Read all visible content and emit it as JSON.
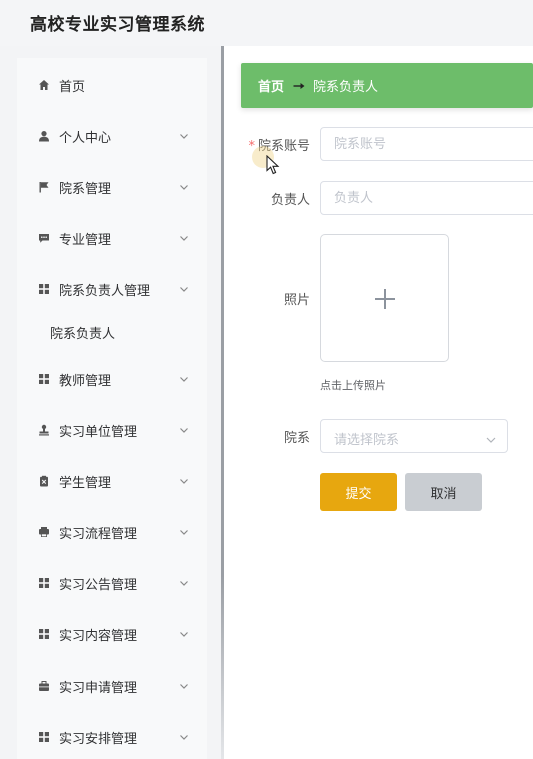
{
  "app": {
    "title": "高校专业实习管理系统"
  },
  "sidebar": {
    "items": [
      {
        "label": "首页",
        "icon": "home-icon",
        "has_chevron": false
      },
      {
        "label": "个人中心",
        "icon": "user-icon",
        "has_chevron": true
      },
      {
        "label": "院系管理",
        "icon": "flag-icon",
        "has_chevron": true
      },
      {
        "label": "专业管理",
        "icon": "chat-icon",
        "has_chevron": true
      },
      {
        "label": "院系负责人管理",
        "icon": "grid-icon",
        "has_chevron": true,
        "expanded": true
      },
      {
        "label": "教师管理",
        "icon": "grid-icon",
        "has_chevron": true
      },
      {
        "label": "实习单位管理",
        "icon": "stamp-icon",
        "has_chevron": true
      },
      {
        "label": "学生管理",
        "icon": "clipboard-icon",
        "has_chevron": true
      },
      {
        "label": "实习流程管理",
        "icon": "printer-icon",
        "has_chevron": true
      },
      {
        "label": "实习公告管理",
        "icon": "grid-icon",
        "has_chevron": true
      },
      {
        "label": "实习内容管理",
        "icon": "grid-icon",
        "has_chevron": true
      },
      {
        "label": "实习申请管理",
        "icon": "briefcase-icon",
        "has_chevron": true
      },
      {
        "label": "实习安排管理",
        "icon": "grid-icon",
        "has_chevron": true
      }
    ],
    "sub_item": "院系负责人"
  },
  "breadcrumb": {
    "home": "首页",
    "current": "院系负责人"
  },
  "form": {
    "account": {
      "label": "院系账号",
      "placeholder": "院系账号",
      "required": true
    },
    "manager": {
      "label": "负责人",
      "placeholder": "负责人"
    },
    "photo": {
      "label": "照片",
      "tip": "点击上传照片"
    },
    "department": {
      "label": "院系",
      "placeholder": "请选择院系"
    }
  },
  "buttons": {
    "submit": "提交",
    "cancel": "取消"
  },
  "colors": {
    "breadcrumb_bg": "#6dbd6a",
    "submit_bg": "#e7a70f",
    "cancel_bg": "#c9cdd2",
    "required": "#f56c6c"
  }
}
